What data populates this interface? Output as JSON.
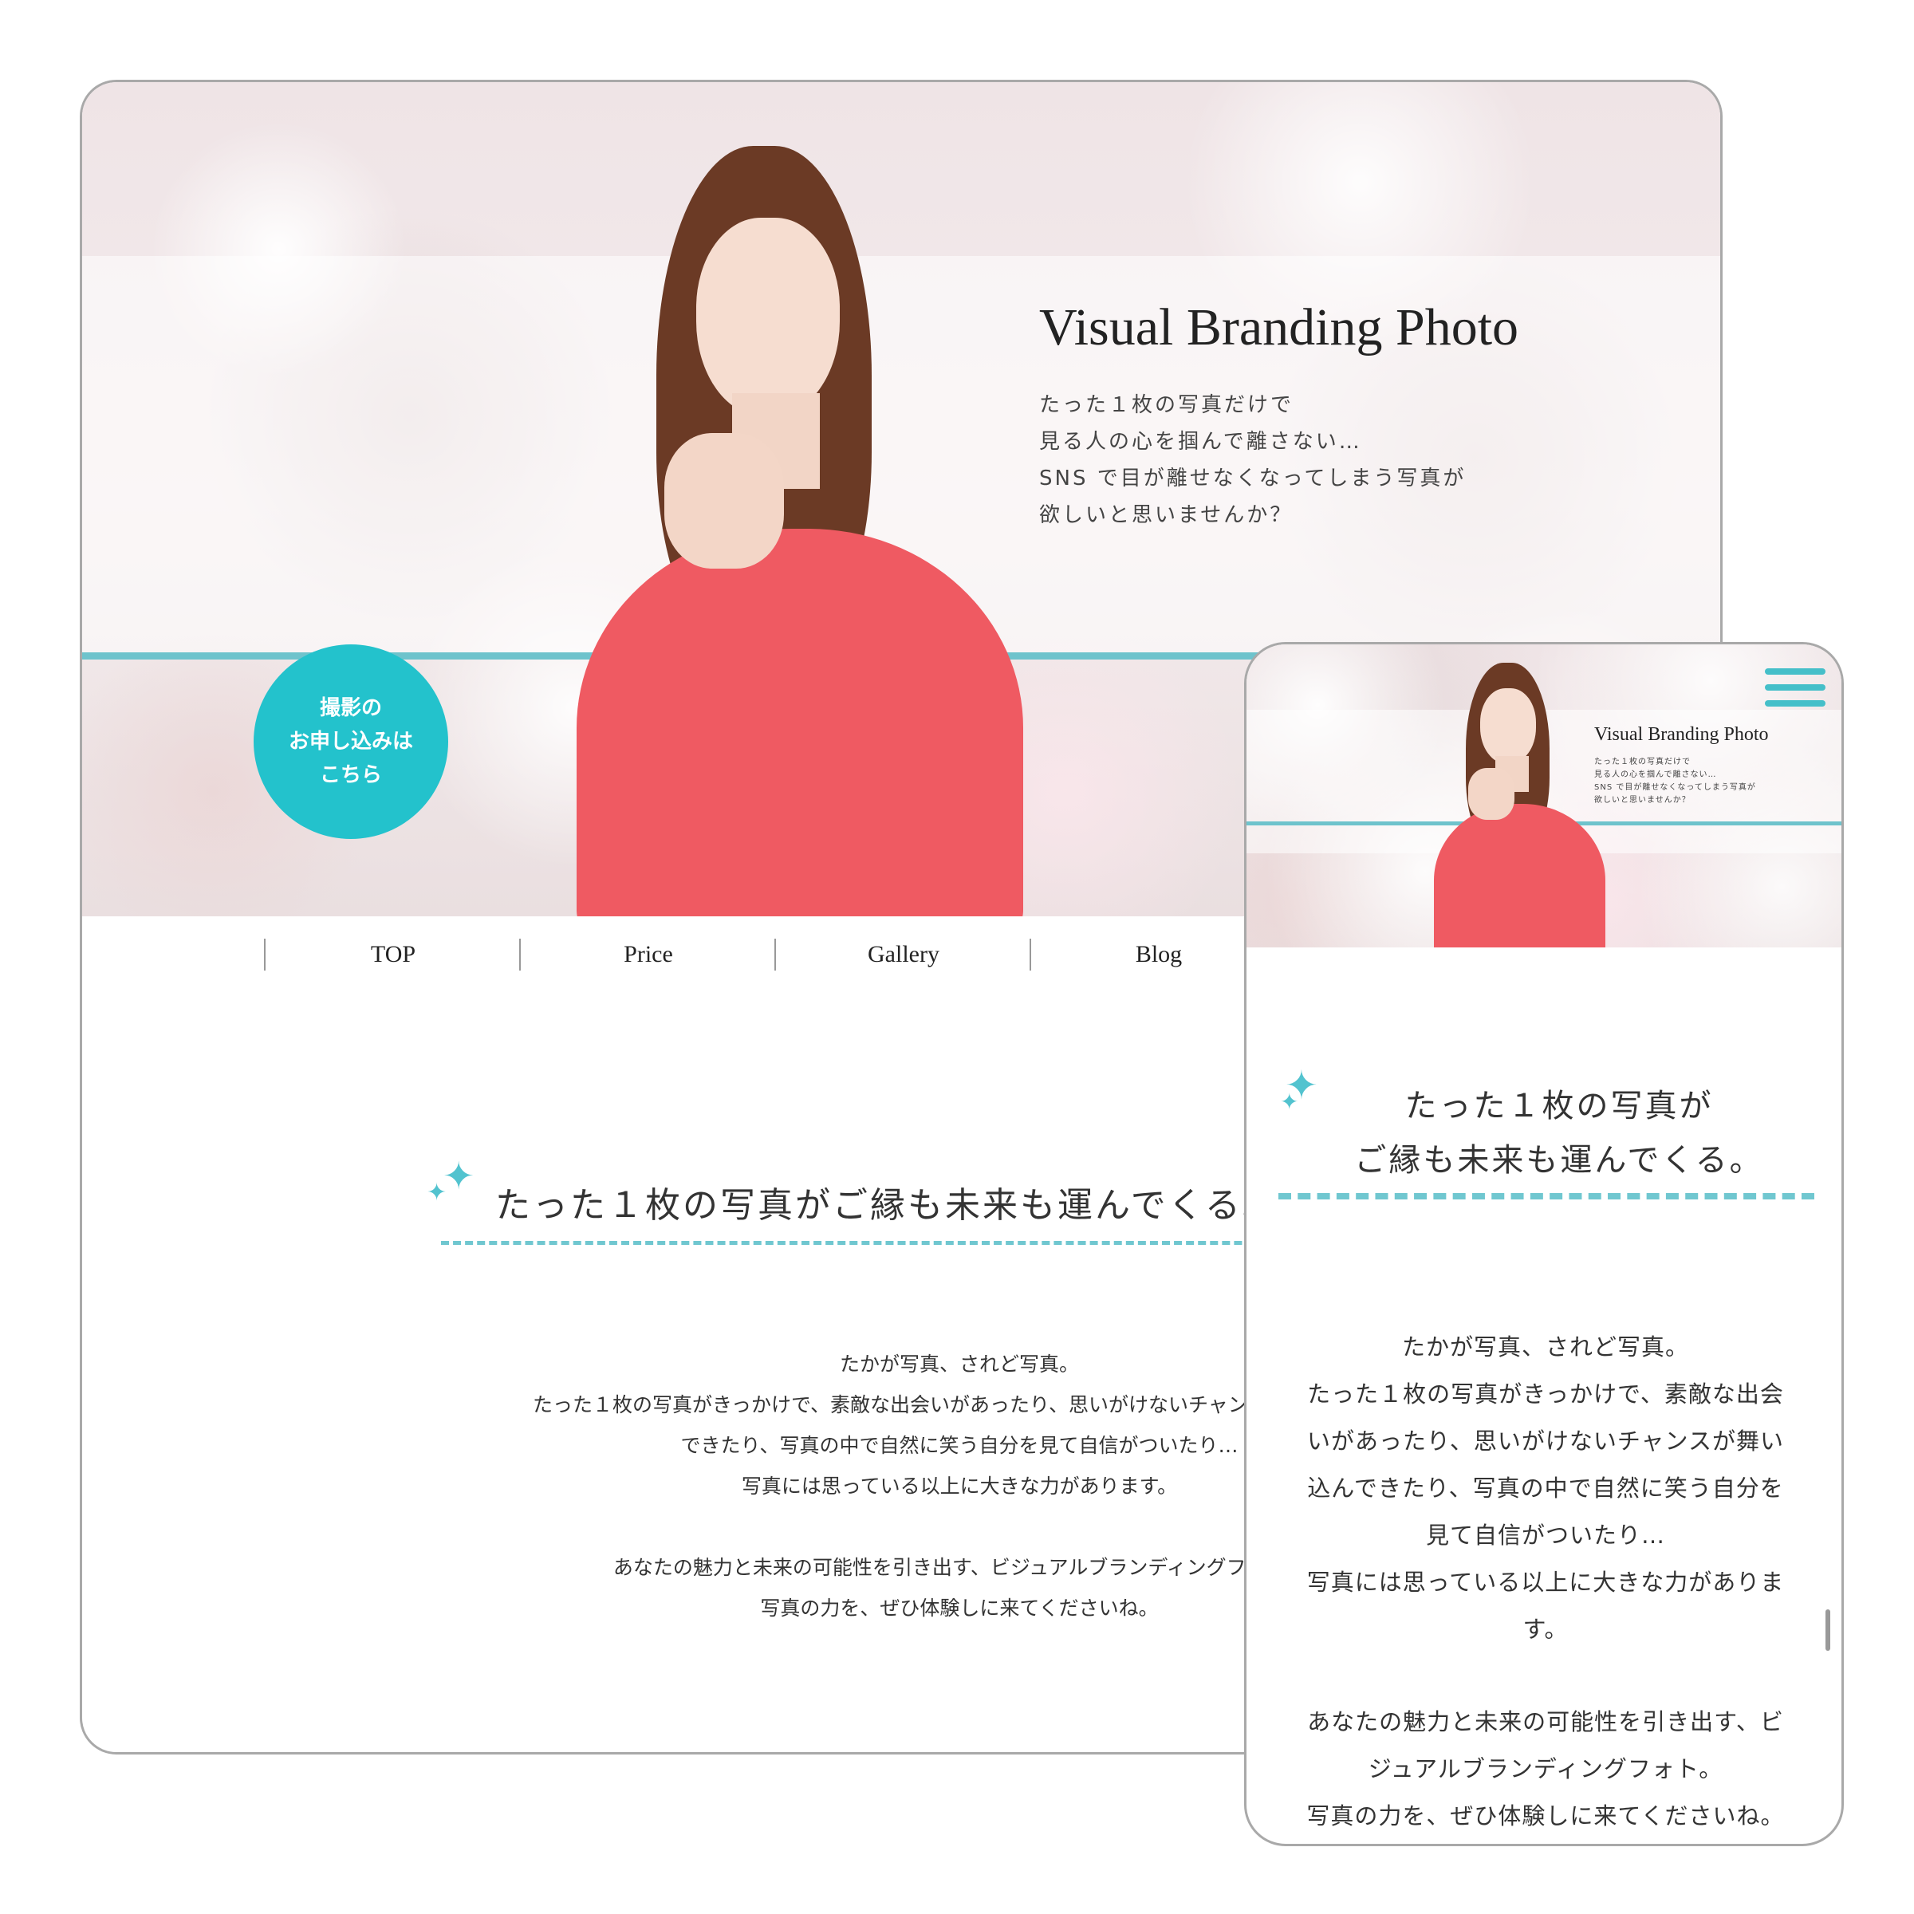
{
  "brand": {
    "title": "Visual Branding Photo",
    "tagline": "たった１枚の写真だけで\n見る人の心を掴んで離さない…\nSNS で目が離せなくなってしまう写真が\n欲しいと思いませんか？"
  },
  "cta": {
    "label": "撮影の\nお申し込みは\nこちら"
  },
  "nav": {
    "items": [
      "TOP",
      "Price",
      "Gallery",
      "Blog"
    ]
  },
  "section": {
    "heading_desktop": "たった１枚の写真がご縁も未来も運んでくる。",
    "heading_mobile": "たった１枚の写真が\nご縁も未来も運んでくる。",
    "paragraph1": "たかが写真、されど写真。\nたった１枚の写真がきっかけで、素敵な出会いがあったり、思いがけないチャンスが舞い込んで\nできたり、写真の中で自然に笑う自分を見て自信がついたり…\n写真には思っている以上に大きな力があります。",
    "paragraph2": "あなたの魅力と未来の可能性を引き出す、ビジュアルブランディングフォト。\n写真の力を、ぜひ体験しに来てくださいね。",
    "mobile_paragraph1": "たかが写真、されど写真。\nたった１枚の写真がきっかけで、素敵な出会\nいがあったり、思いがけないチャンスが舞い\n込んできたり、写真の中で自然に笑う自分を\n見て自信がついたり…\n写真には思っている以上に大きな力がありま\nす。",
    "mobile_paragraph2": "あなたの魅力と未来の可能性を引き出す、ビ\nジュアルブランディングフォト。\n写真の力を、ぜひ体験しに来てくださいね。"
  },
  "icons": {
    "sparkle": "sparkle-icon",
    "menu": "hamburger-menu-icon"
  },
  "colors": {
    "accent": "#23c2cc",
    "line": "#6ec3cc",
    "sweater": "#ef5a62"
  }
}
